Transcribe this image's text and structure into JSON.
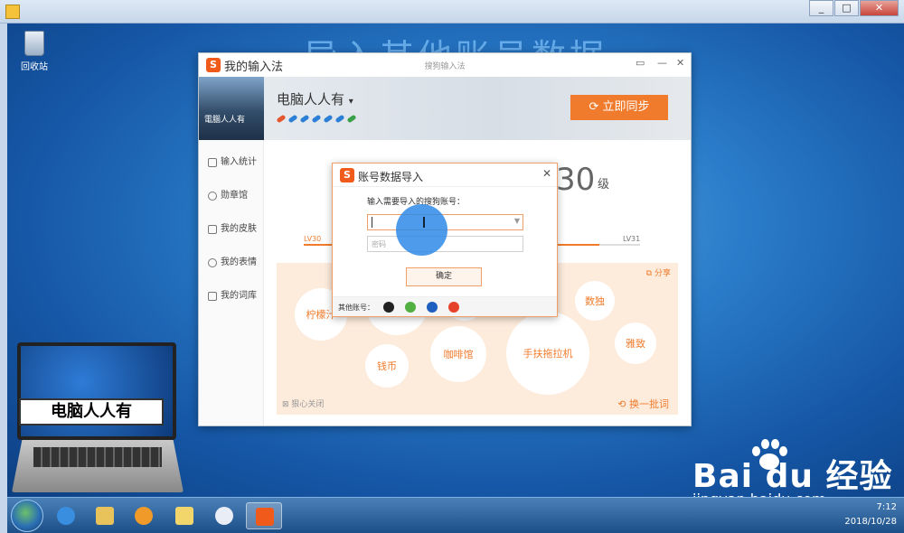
{
  "outer_window": {
    "controls": [
      "_",
      "□",
      "✕"
    ]
  },
  "desktop": {
    "recycle_bin_label": "回收站",
    "banner": "导入其他账号数据"
  },
  "ime_window": {
    "title": "我的输入法",
    "subtitle": "搜狗输入法",
    "logo_glyph": "S",
    "title_controls": [
      "▭",
      "—",
      "✕"
    ],
    "username": "电脑人人有",
    "username_caret": "▾",
    "avatar_caption": "電腦人人有",
    "sync_button": "立即同步",
    "sync_icon": "refresh-icon",
    "sidebar": [
      {
        "label": "输入统计",
        "icon": "chart-icon"
      },
      {
        "label": "勋章馆",
        "icon": "medal-icon"
      },
      {
        "label": "我的皮肤",
        "icon": "shirt-icon"
      },
      {
        "label": "我的表情",
        "icon": "smile-icon"
      },
      {
        "label": "我的词库",
        "icon": "book-icon"
      }
    ],
    "level_number": "30",
    "level_unit": "级",
    "lv_left": "LV30",
    "lv_right": "LV31",
    "level_progress": 0.88,
    "share": "分享",
    "unfollow": "狠心关闭",
    "refresh": "换一批词",
    "word_bubbles": [
      "柠檬汁",
      "数独",
      "钱币",
      "咖啡馆",
      "手扶拖拉机",
      "雅致"
    ]
  },
  "dialog": {
    "title": "账号数据导入",
    "prompt": "输入需要导入的搜狗账号：",
    "account_value": "",
    "password_placeholder": "密码",
    "ok_button": "确定",
    "other_accounts_label": "其他账号：",
    "other_accounts": [
      "qq-icon",
      "wechat-icon",
      "sogou-icon",
      "weibo-icon"
    ]
  },
  "laptop_logo": {
    "label": "电脑人人有"
  },
  "watermark": {
    "brand": "Bai du 经验",
    "url": "jingyan.baidu.com"
  },
  "taskbar": {
    "apps": [
      "ie-icon",
      "explorer-icon",
      "media-player-icon",
      "folder-icon",
      "pinwheel-icon",
      "sogou-icon"
    ],
    "time": "7:12",
    "date": "2018/10/28"
  },
  "colors": {
    "accent_orange": "#f07b2c",
    "desktop_blue": "#2a7cc9"
  }
}
